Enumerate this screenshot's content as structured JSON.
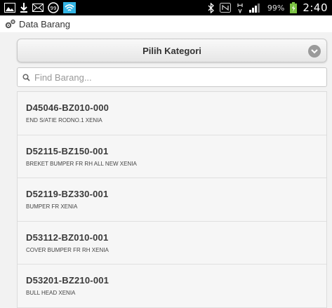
{
  "statusbar": {
    "battery_percent": "99%",
    "time": "2:40",
    "icons": [
      "gallery-icon",
      "download-icon",
      "mail-icon",
      "notification-99-icon",
      "wifi-icon",
      "bluetooth-icon",
      "nfc-icon",
      "data-icon",
      "signal-icon",
      "battery-icon"
    ],
    "badge_count": "99"
  },
  "header": {
    "title": "Data Barang",
    "icon": "gears-icon"
  },
  "category_select": {
    "label": "Pilih Kategori",
    "icon": "chevron-down-circle-icon"
  },
  "search": {
    "placeholder": "Find Barang...",
    "value": "",
    "icon": "search-icon"
  },
  "items": [
    {
      "code": "D45046-BZ010-000",
      "name": "END S/ATIE RODNO.1 XENIA"
    },
    {
      "code": "D52115-BZ150-001",
      "name": "BREKET BUMPER FR RH ALL NEW XENIA"
    },
    {
      "code": "D52119-BZ330-001",
      "name": "BUMPER FR XENIA"
    },
    {
      "code": "D53112-BZ010-001",
      "name": "COVER BUMPER FR RH XENIA"
    },
    {
      "code": "D53201-BZ210-001",
      "name": "BULL HEAD XENIA"
    }
  ],
  "colors": {
    "statusbar_bg": "#000000",
    "wifi": "#33b5e5",
    "battery_charge": "#7bc242",
    "page_bg": "#f2f2f2"
  }
}
